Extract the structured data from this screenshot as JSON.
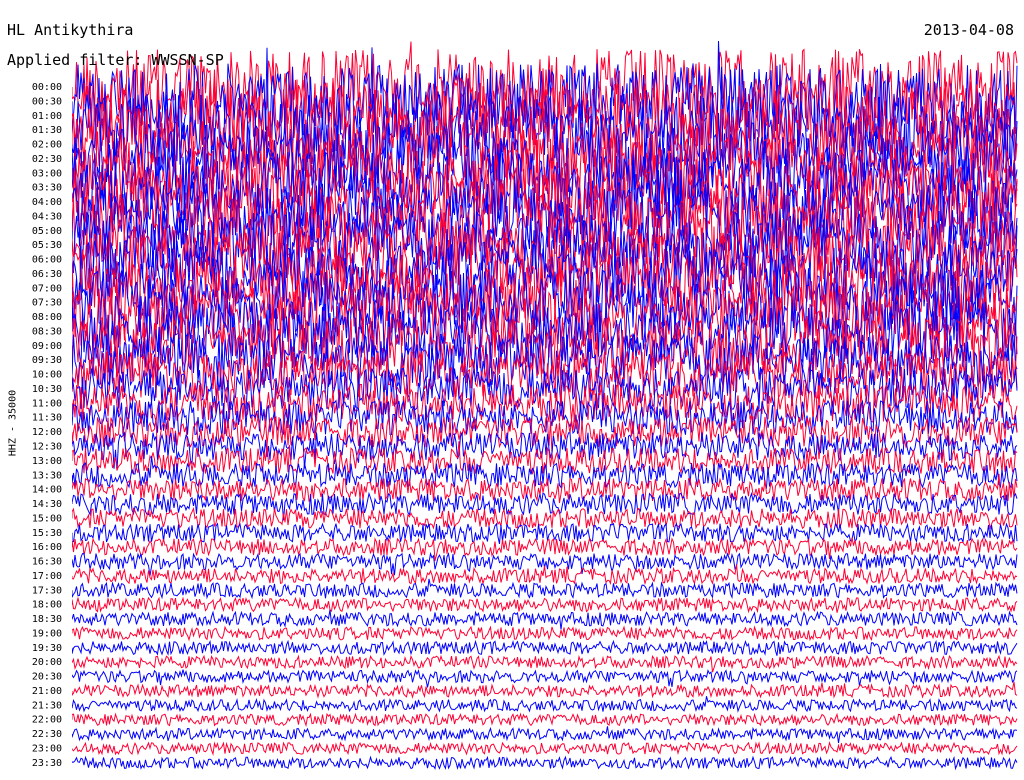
{
  "header": {
    "station": "HL Antikythira",
    "filter": "Applied filter: WWSSN-SP",
    "date": "2013-04-08"
  },
  "chart_data": {
    "type": "line",
    "title": "HL Antikythira",
    "ylabel": "HHZ - 35000",
    "row_labels": [
      "00:00",
      "00:30",
      "01:00",
      "01:30",
      "02:00",
      "02:30",
      "03:00",
      "03:30",
      "04:00",
      "04:30",
      "05:00",
      "05:30",
      "06:00",
      "06:30",
      "07:00",
      "07:30",
      "08:00",
      "08:30",
      "09:00",
      "09:30",
      "10:00",
      "10:30",
      "11:00",
      "11:30",
      "12:00",
      "12:30",
      "13:00",
      "13:30",
      "14:00",
      "14:30",
      "15:00",
      "15:30",
      "16:00",
      "16:30",
      "17:00",
      "17:30",
      "18:00",
      "18:30",
      "19:00",
      "19:30",
      "20:00",
      "20:30",
      "21:00",
      "21:30",
      "22:00",
      "22:30",
      "23:00",
      "23:30"
    ],
    "trace_colors": [
      "#ff0033",
      "#0000ff"
    ],
    "noise_level": [
      1.0,
      1.0,
      0.98,
      0.97,
      0.96,
      0.95,
      0.95,
      0.94,
      0.93,
      0.92,
      0.92,
      0.91,
      0.9,
      0.89,
      0.88,
      0.86,
      0.84,
      0.8,
      0.75,
      0.7,
      0.62,
      0.55,
      0.5,
      0.45,
      0.4,
      0.37,
      0.34,
      0.32,
      0.3,
      0.28,
      0.26,
      0.24,
      0.22,
      0.21,
      0.2,
      0.19,
      0.18,
      0.18,
      0.17,
      0.17,
      0.16,
      0.16,
      0.16,
      0.15,
      0.15,
      0.15,
      0.15,
      0.15
    ],
    "grid": false
  }
}
